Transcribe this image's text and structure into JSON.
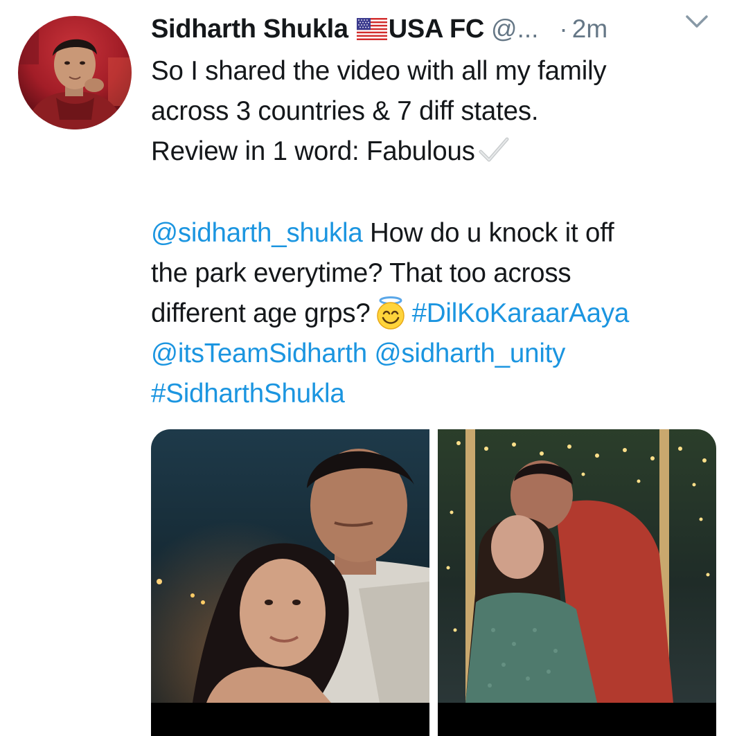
{
  "tweet": {
    "display_name": "Sidharth Shukla",
    "display_suffix": "USA FC",
    "handle": "@...",
    "separator": "·",
    "timestamp": "2m",
    "avatar": "avatar-photo",
    "flag_icon": "us-flag-icon",
    "caret_icon": "chevron-down-icon",
    "text": {
      "line1": "So I shared the video with all my family",
      "line2": "across 3 countries & 7 diff states.",
      "line3": "Review in 1 word: Fabulous",
      "check_icon": "check-mark-icon",
      "mention1": "@sidharth_shukla",
      "line4_rest": " How do u knock it off",
      "line5": "the park everytime? That too across",
      "line6_start": "different age grps?",
      "emoji_icon": "smiling-face-with-halo-icon",
      "hashtag1": "#DilKoKaraarAaya",
      "mention2": "@itsTeamSidharth",
      "mention3": "@sidharth_unity",
      "hashtag2": "#SidharthShukla"
    },
    "media": [
      {
        "name": "couple-embrace-photo"
      },
      {
        "name": "couple-swing-kiss-photo"
      }
    ],
    "colors": {
      "text": "#14171a",
      "secondary": "#657786",
      "link": "#1b95e0"
    }
  }
}
